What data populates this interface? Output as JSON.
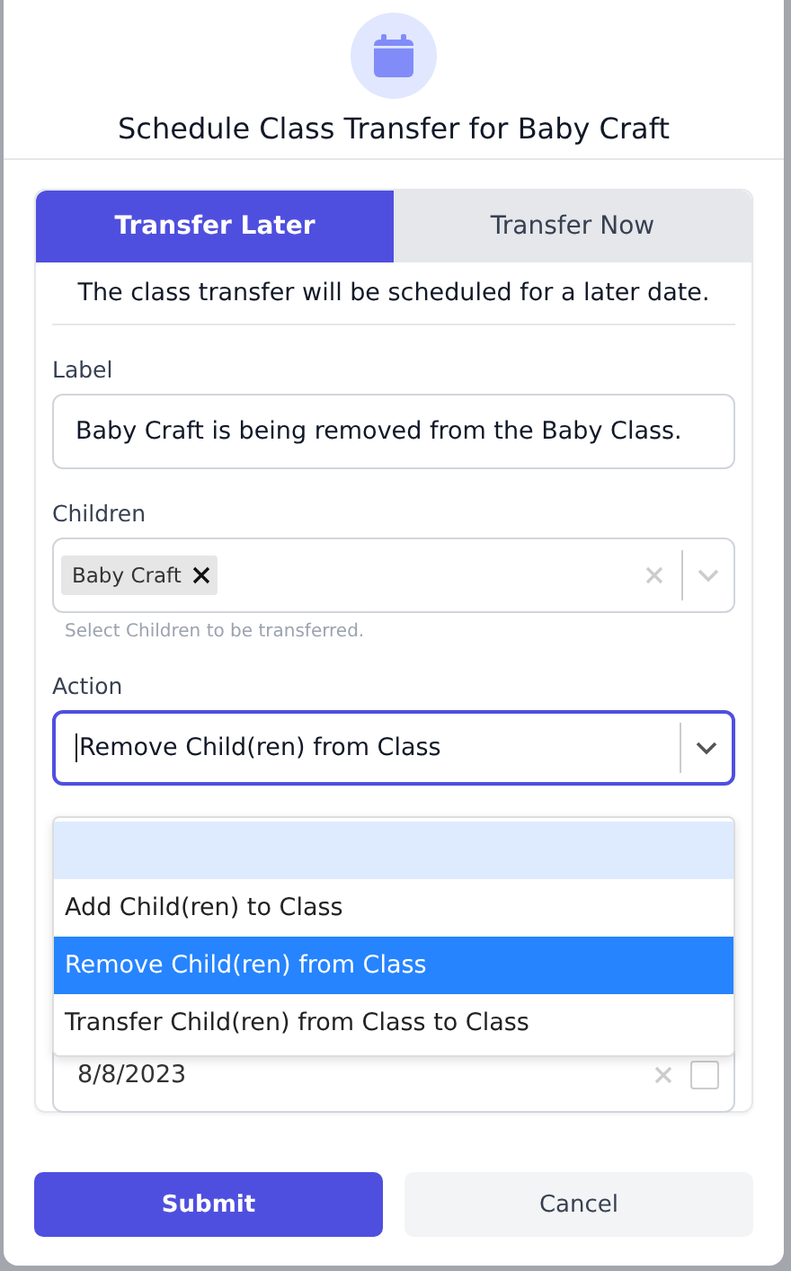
{
  "dialog": {
    "title": "Schedule Class Transfer for Baby Craft"
  },
  "tabs": [
    {
      "label": "Transfer Later",
      "selected": true
    },
    {
      "label": "Transfer Now",
      "selected": false
    }
  ],
  "description": "The class transfer will be scheduled for a later date.",
  "label_field": {
    "label": "Label",
    "value": "Baby Craft is being removed from the Baby Class."
  },
  "children_field": {
    "label": "Children",
    "tags": [
      "Baby Craft"
    ],
    "hint": "Select Children to be transferred."
  },
  "action_field": {
    "label": "Action",
    "value": "Remove Child(ren) from Class",
    "focused": true
  },
  "action_options": [
    {
      "kind": "blank",
      "focused": true,
      "selected": false
    },
    {
      "kind": "option",
      "label": "Add Child(ren) to Class",
      "focused": false,
      "selected": false
    },
    {
      "kind": "option",
      "label": "Remove Child(ren) from Class",
      "focused": false,
      "selected": true
    },
    {
      "kind": "option",
      "label": "Transfer Child(ren) from Class to Class",
      "focused": false,
      "selected": false
    }
  ],
  "date_field": {
    "value": "8/8/2023"
  },
  "buttons": [
    {
      "label": "Submit",
      "kind": "primary"
    },
    {
      "label": "Cancel",
      "kind": "secondary"
    }
  ]
}
